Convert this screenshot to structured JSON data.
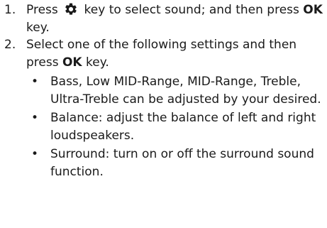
{
  "steps": [
    {
      "num": "1.",
      "parts": {
        "before_icon": "Press ",
        "icon": "gear-icon",
        "after_icon": " key to select sound; and then press ",
        "key": "OK",
        "after_key": " key."
      }
    },
    {
      "num": "2.",
      "parts": {
        "before_key": "Select one of the following settings and then press ",
        "key": "OK",
        "after_key": " key."
      },
      "bullets": [
        "Bass, Low MID-Range, MID-Range, Treble, Ultra-Treble can be adjusted by your desired.",
        "Balance: adjust the balance of left and right loudspeakers.",
        "Surround: turn on or off the surround sound function."
      ]
    }
  ],
  "bullet_char": "•"
}
